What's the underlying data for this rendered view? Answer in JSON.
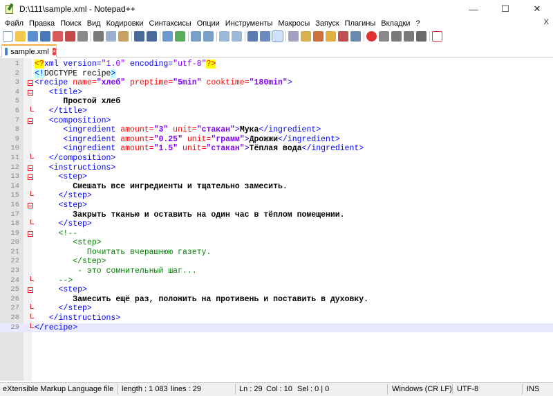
{
  "window": {
    "title": "D:\\111\\sample.xml - Notepad++",
    "minimize": "—",
    "maximize": "☐",
    "close": "✕"
  },
  "menu": {
    "items": [
      "Файл",
      "Правка",
      "Поиск",
      "Вид",
      "Кодировки",
      "Синтаксисы",
      "Опции",
      "Инструменты",
      "Макросы",
      "Запуск",
      "Плагины",
      "Вкладки",
      "?"
    ],
    "close_label": "X"
  },
  "tab": {
    "label": "sample.xml",
    "close": "×"
  },
  "editor": {
    "line_numbers": [
      "1",
      "2",
      "3",
      "4",
      "5",
      "6",
      "7",
      "8",
      "9",
      "10",
      "11",
      "12",
      "13",
      "14",
      "15",
      "16",
      "17",
      "18",
      "19",
      "20",
      "21",
      "22",
      "23",
      "24",
      "25",
      "26",
      "27",
      "28",
      "29"
    ],
    "current_line": 29
  },
  "status": {
    "file_type": "eXtensible Markup Language file",
    "length": "length : 1 083",
    "lines": "lines : 29",
    "ln": "Ln : 29",
    "col": "Col : 10",
    "sel": "Sel : 0 | 0",
    "eol": "Windows (CR LF)",
    "encoding": "UTF-8",
    "mode": "INS"
  },
  "code": {
    "l1_a": "<?",
    "l1_b": "xml version=",
    "l1_c": "\"1.0\"",
    "l1_d": " encoding=",
    "l1_e": "\"utf-8\"",
    "l1_f": "?>",
    "l2_a": "<!",
    "l2_b": "DOCTYPE recipe",
    "l2_c": ">",
    "l3_a": "<recipe",
    "l3_b": " name=",
    "l3_c": "\"хлеб\"",
    "l3_d": " preptime=",
    "l3_e": "\"5min\"",
    "l3_f": " cooktime=",
    "l3_g": "\"180min\"",
    "l3_h": ">",
    "l4": "<title>",
    "l5": "Простой хлеб",
    "l6": "</title>",
    "l7": "<composition>",
    "l8_a": "<ingredient",
    "l8_b": " amount=",
    "l8_c": "\"3\"",
    "l8_d": " unit=",
    "l8_e": "\"стакан\"",
    "l8_f": ">",
    "l8_g": "Мука",
    "l8_h": "</ingredient>",
    "l9_a": "<ingredient",
    "l9_b": " amount=",
    "l9_c": "\"0.25\"",
    "l9_d": " unit=",
    "l9_e": "\"грамм\"",
    "l9_f": ">",
    "l9_g": "Дрожжи",
    "l9_h": "</ingredient>",
    "l10_a": "<ingredient",
    "l10_b": " amount=",
    "l10_c": "\"1.5\"",
    "l10_d": " unit=",
    "l10_e": "\"стакан\"",
    "l10_f": ">",
    "l10_g": "Тёплая вода",
    "l10_h": "</ingredient>",
    "l11": "</composition>",
    "l12": "<instructions>",
    "l13": "<step>",
    "l14": "Смешать все ингредиенты и тщательно замесить.",
    "l15": "</step>",
    "l16": "<step>",
    "l17": "Закрыть тканью и оставить на один час в тёплом помещении.",
    "l18": "</step>",
    "l19": "<!--",
    "l20": "<step>",
    "l21": "Почитать вчерашнюю газету.",
    "l22": "</step>",
    "l23": "- это сомнительный шаг...",
    "l24": "-->",
    "l25": "<step>",
    "l26": "Замесить ещё раз, положить на противень и поставить в духовку.",
    "l27": "</step>",
    "l28": "</instructions>",
    "l29": "</recipe>"
  }
}
